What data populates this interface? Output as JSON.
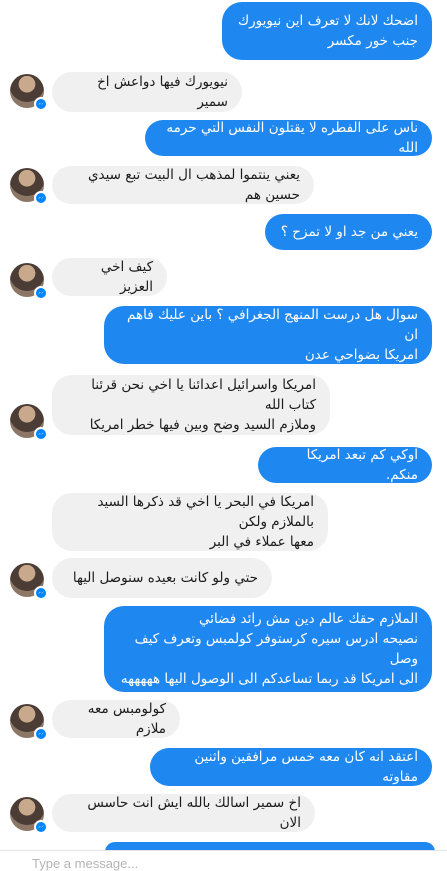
{
  "messages": [
    {
      "side": "out",
      "text": "اضحك لانك  لا تعرف اين نيويورك\nجنب خور مكسر"
    },
    {
      "side": "in",
      "text": "نيويورك فيها دواعش اخ سمير"
    },
    {
      "side": "out",
      "text": "ناس على الفطره لا يقتلون النفس التي حرمه الله"
    },
    {
      "side": "in",
      "text": "يعني ينتموا لمذهب ال البيت تبع سيدي حسين هم"
    },
    {
      "side": "out",
      "text": "يعني من جد او لا تمزح ؟"
    },
    {
      "side": "in",
      "text": "كيف اخي العزيز"
    },
    {
      "side": "out",
      "text": "سوال  هل درست المنهج الجغرافي ؟ باين عليك فاهم ان\nامريكا بضواحي عدن"
    },
    {
      "side": "in",
      "text": "امريكا واسرائيل اعدائنا يا اخي نحن قرئنا كتاب الله\nوملازم السيد وضح وبين فيها خطر امريكا"
    },
    {
      "side": "out",
      "text": "اوكي كم تبعد امريكا منكم."
    },
    {
      "side": "in",
      "text": "امريكا في البحر يا اخي قد ذكرها السيد بالملازم ولكن\nمعها عملاء في البر"
    },
    {
      "side": "in",
      "text": "حتي ولو كانت بعيده سنوصل اليها"
    },
    {
      "side": "out",
      "text": "الملازم حقك  عالم دين مش رائد فضائي\nنصيحه ادرس سيره كرستوفر كولمبس وتعرف كيف وصل\nالى امريكا قد ربما تساعدكم الى الوصول اليها هههههه"
    },
    {
      "side": "in",
      "text": "كولومبس معه ملازم"
    },
    {
      "side": "out",
      "text": "اعتقد انه كان معه خمس مرافقين  واثنين مقاوته"
    },
    {
      "side": "in",
      "text": "اخ سمير اسالك بالله ايش انت حاسس الان"
    }
  ],
  "composer": {
    "placeholder": "Type a message..."
  },
  "colors": {
    "outgoing": "#1e88f0",
    "incoming": "#f1f0f0",
    "badge": "#0084ff"
  },
  "icons": {
    "avatar_badge": "messenger-icon"
  }
}
